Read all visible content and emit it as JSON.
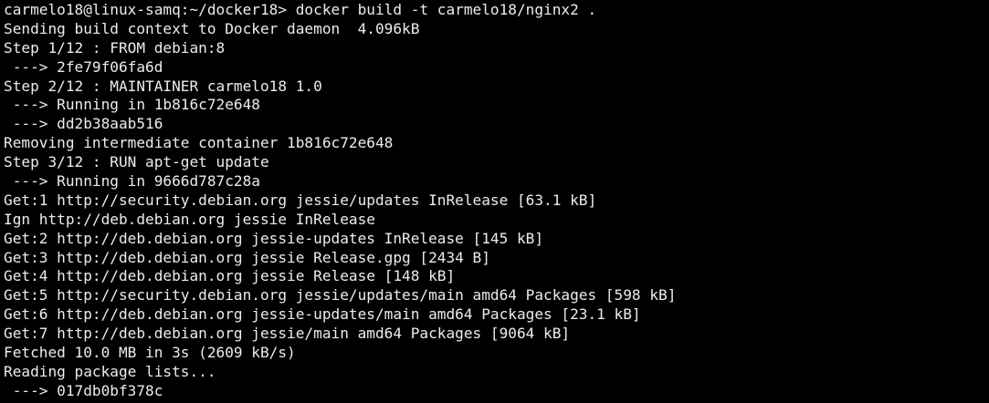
{
  "terminal": {
    "background": "#000000",
    "foreground": "#ececec",
    "lines": [
      "carmelo18@linux-samq:~/docker18> docker build -t carmelo18/nginx2 .",
      "Sending build context to Docker daemon  4.096kB",
      "Step 1/12 : FROM debian:8",
      " ---> 2fe79f06fa6d",
      "Step 2/12 : MAINTAINER carmelo18 1.0",
      " ---> Running in 1b816c72e648",
      " ---> dd2b38aab516",
      "Removing intermediate container 1b816c72e648",
      "Step 3/12 : RUN apt-get update",
      " ---> Running in 9666d787c28a",
      "Get:1 http://security.debian.org jessie/updates InRelease [63.1 kB]",
      "Ign http://deb.debian.org jessie InRelease",
      "Get:2 http://deb.debian.org jessie-updates InRelease [145 kB]",
      "Get:3 http://deb.debian.org jessie Release.gpg [2434 B]",
      "Get:4 http://deb.debian.org jessie Release [148 kB]",
      "Get:5 http://security.debian.org jessie/updates/main amd64 Packages [598 kB]",
      "Get:6 http://deb.debian.org jessie-updates/main amd64 Packages [23.1 kB]",
      "Get:7 http://deb.debian.org jessie/main amd64 Packages [9064 kB]",
      "Fetched 10.0 MB in 3s (2609 kB/s)",
      "Reading package lists...",
      " ---> 017db0bf378c"
    ]
  }
}
